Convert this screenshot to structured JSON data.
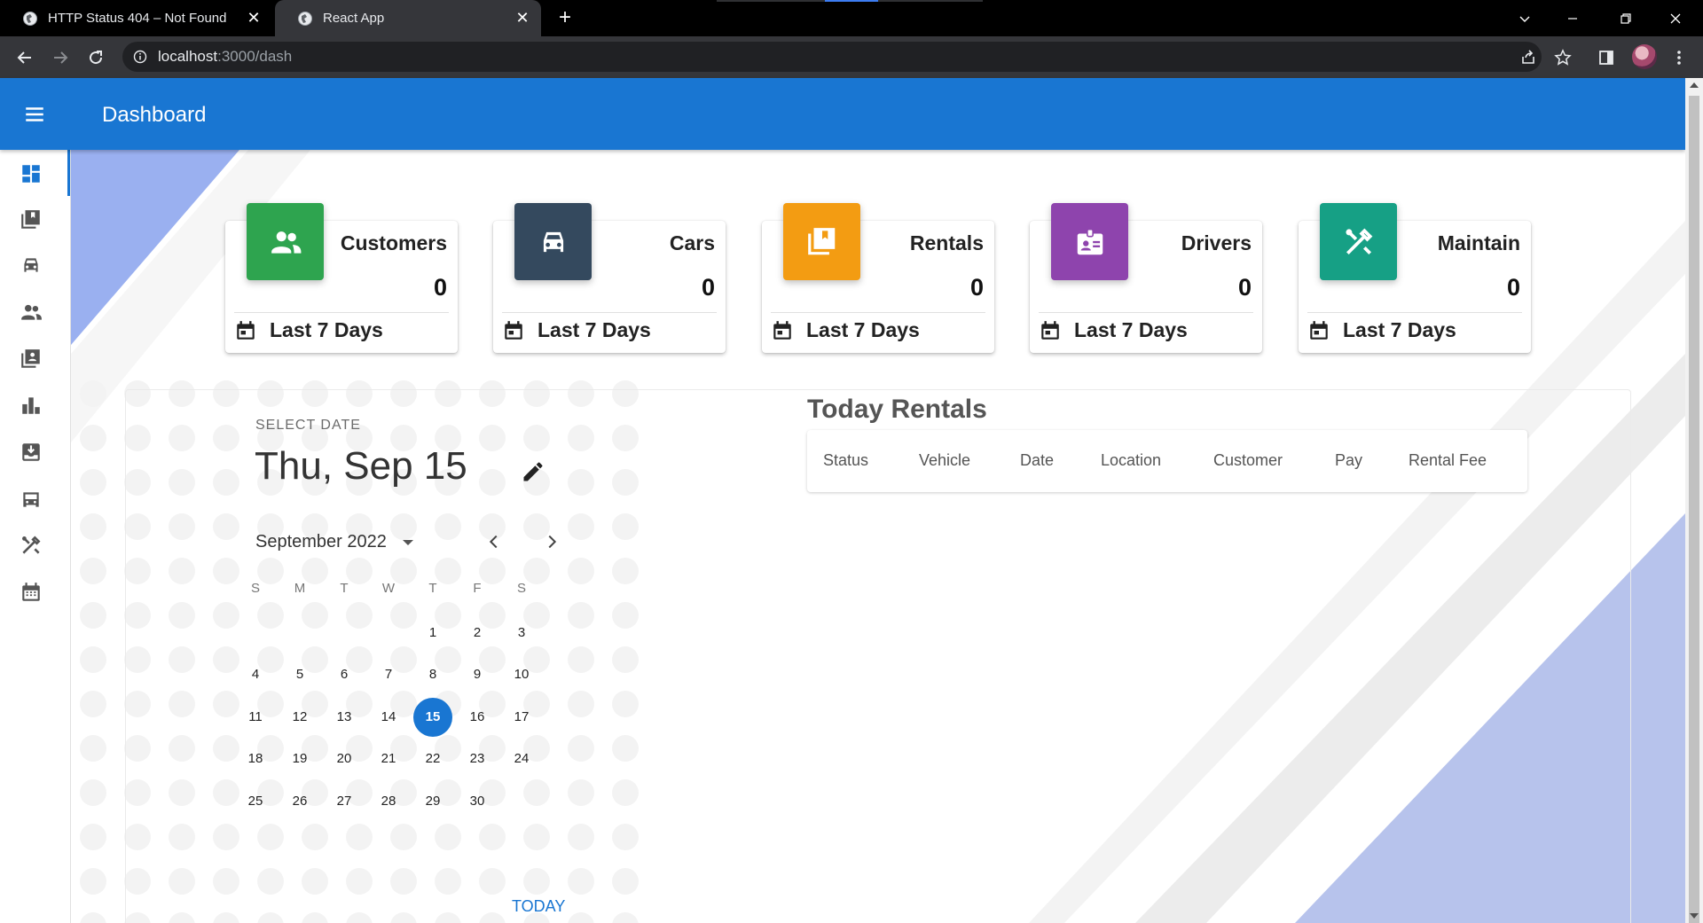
{
  "browser": {
    "tabs": [
      {
        "title": "HTTP Status 404 – Not Found",
        "active": false
      },
      {
        "title": "React App",
        "active": true
      }
    ],
    "url_host": "localhost",
    "url_path": ":3000/dash"
  },
  "app": {
    "title": "Dashboard",
    "accent_color": "#1976d2"
  },
  "sidebar": {
    "items": [
      {
        "icon": "dashboard-icon",
        "active": true
      },
      {
        "icon": "library-books-icon",
        "active": false
      },
      {
        "icon": "car-icon",
        "active": false
      },
      {
        "icon": "people-icon",
        "active": false
      },
      {
        "icon": "contacts-book-icon",
        "active": false
      },
      {
        "icon": "bar-chart-icon",
        "active": false
      },
      {
        "icon": "download-box-icon",
        "active": false
      },
      {
        "icon": "car-front-icon",
        "active": false
      },
      {
        "icon": "tools-icon",
        "active": false
      },
      {
        "icon": "calendar-icon",
        "active": false
      }
    ]
  },
  "stats": [
    {
      "label": "Customers",
      "value": "0",
      "footer": "Last 7 Days",
      "color": "#2ea44f",
      "icon": "people-icon"
    },
    {
      "label": "Cars",
      "value": "0",
      "footer": "Last 7 Days",
      "color": "#34495e",
      "icon": "car-icon"
    },
    {
      "label": "Rentals",
      "value": "0",
      "footer": "Last 7 Days",
      "color": "#f39c12",
      "icon": "library-books-icon"
    },
    {
      "label": "Drivers",
      "value": "0",
      "footer": "Last 7 Days",
      "color": "#8e44ad",
      "icon": "badge-icon"
    },
    {
      "label": "Maintain",
      "value": "0",
      "footer": "Last 7 Days",
      "color": "#16a085",
      "icon": "tools-icon"
    }
  ],
  "calendar": {
    "select_label": "SELECT DATE",
    "selected_date": "Thu, Sep 15",
    "month_label": "September 2022",
    "weekdays": [
      "S",
      "M",
      "T",
      "W",
      "T",
      "F",
      "S"
    ],
    "first_weekday_index": 4,
    "days_in_month": 30,
    "selected_day": 15,
    "today_label": "TODAY"
  },
  "rentals": {
    "title": "Today Rentals",
    "columns": [
      "Status",
      "Vehicle",
      "Date",
      "Location",
      "Customer",
      "Pay",
      "Rental Fee"
    ]
  }
}
